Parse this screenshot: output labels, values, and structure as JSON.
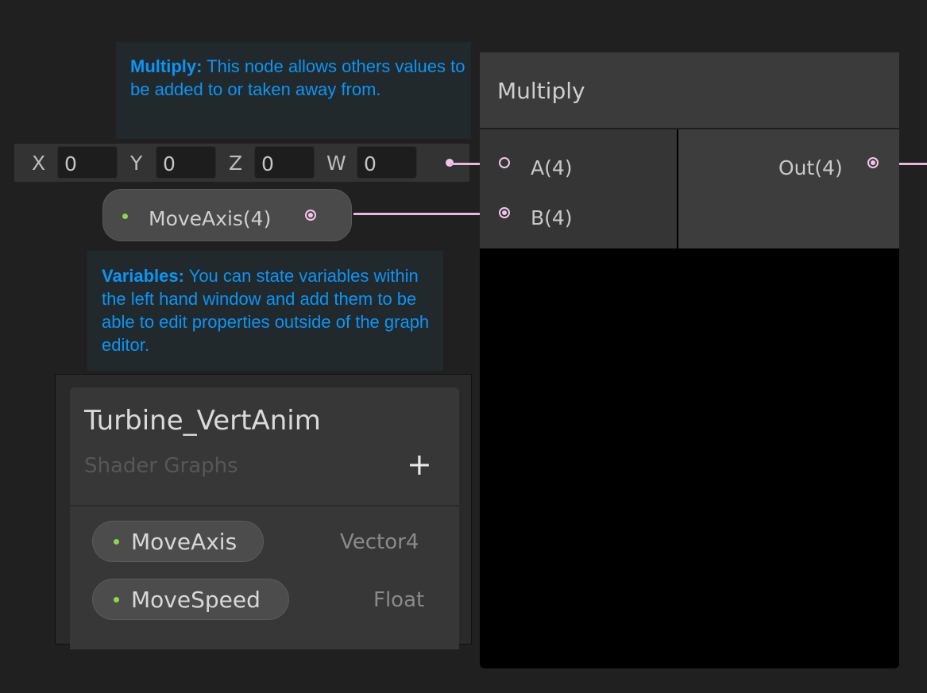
{
  "callouts": {
    "multiply": {
      "title": "Multiply:",
      "text": " This node allows others values to be added to or taken away from."
    },
    "variables": {
      "title": "Variables:",
      "text": " You can state variables within the left hand window and add them to be able to edit properties outside of the graph editor."
    }
  },
  "vector_input": {
    "fields": [
      {
        "label": "X",
        "value": "0"
      },
      {
        "label": "Y",
        "value": "0"
      },
      {
        "label": "Z",
        "value": "0"
      },
      {
        "label": "W",
        "value": "0"
      }
    ]
  },
  "property_node": {
    "label": "MoveAxis(4)"
  },
  "multiply_node": {
    "title": "Multiply",
    "inputs": [
      {
        "label": "A(4)"
      },
      {
        "label": "B(4)"
      }
    ],
    "output": {
      "label": "Out(4)"
    }
  },
  "blackboard": {
    "title": "Turbine_VertAnim",
    "subtitle": "Shader Graphs",
    "add_label": "+",
    "properties": [
      {
        "name": "MoveAxis",
        "type": "Vector4"
      },
      {
        "name": "MoveSpeed",
        "type": "Float"
      }
    ]
  },
  "colors": {
    "callout_text": "#0a95f5",
    "port": "#f2c6ea",
    "wire": "#e8b6de",
    "property_dot": "#8cd84a"
  }
}
